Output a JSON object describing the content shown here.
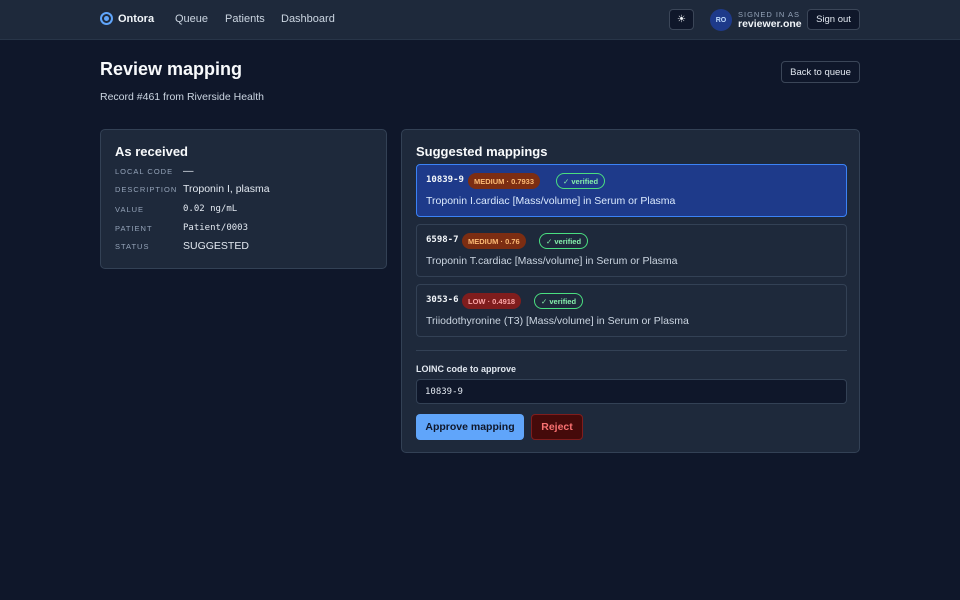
{
  "header": {
    "brand": "Ontora",
    "brand_icon": "target-icon",
    "nav": [
      "Queue",
      "Patients",
      "Dashboard"
    ],
    "theme_toggle_icon": "☀",
    "user_initials": "RO",
    "signed_in_label": "SIGNED IN AS",
    "username": "reviewer.one",
    "signout_label": "Sign out"
  },
  "page": {
    "title": "Review mapping",
    "subtitle": "Record #461 from Riverside Health",
    "back_label": "Back to queue"
  },
  "received": {
    "title": "As received",
    "fields": [
      {
        "label": "LOCAL CODE",
        "value": "—"
      },
      {
        "label": "DESCRIPTION",
        "value": "Troponin I, plasma"
      },
      {
        "label": "VALUE",
        "value": "0.02 ng/mL"
      },
      {
        "label": "PATIENT",
        "value": "Patient/0003"
      },
      {
        "label": "STATUS",
        "value": "SUGGESTED"
      }
    ]
  },
  "suggestions": {
    "title": "Suggested mappings",
    "items": [
      {
        "code": "10839-9",
        "confidence": "MEDIUM · 0.7933",
        "level": "medium",
        "verified": "✓ verified",
        "description": "Troponin I.cardiac [Mass/volume] in Serum or Plasma",
        "selected": true
      },
      {
        "code": "6598-7",
        "confidence": "MEDIUM · 0.76",
        "level": "medium",
        "verified": "✓ verified",
        "description": "Troponin T.cardiac [Mass/volume] in Serum or Plasma",
        "selected": false
      },
      {
        "code": "3053-6",
        "confidence": "LOW · 0.4918",
        "level": "low",
        "verified": "✓ verified",
        "description": "Triiodothyronine (T3) [Mass/volume] in Serum or Plasma",
        "selected": false
      }
    ]
  },
  "approve": {
    "label": "LOINC code to approve",
    "value": "10839-9",
    "approve_label": "Approve mapping",
    "reject_label": "Reject"
  },
  "colors": {
    "background": "#0f172a",
    "surface": "#1e293b",
    "accent": "#60a5fa",
    "selected": "#1e3a8a",
    "medium": "#fdba74",
    "low": "#fca5a5",
    "verified": "#86efac",
    "danger": "#f87171"
  }
}
